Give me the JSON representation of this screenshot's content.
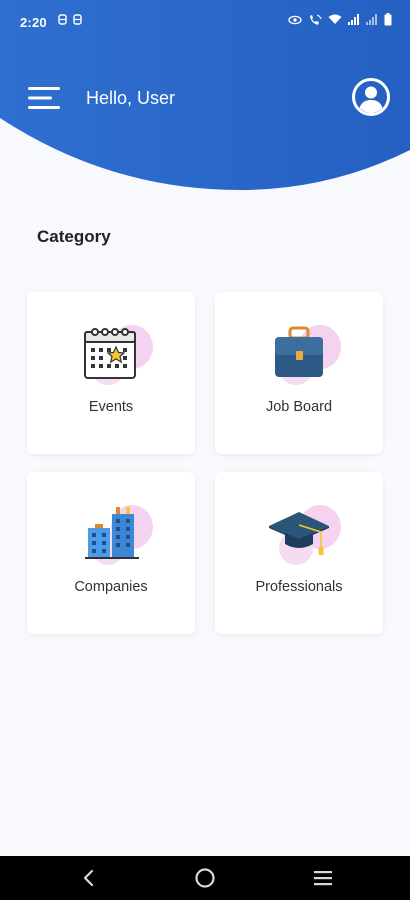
{
  "status_bar": {
    "time": "2:20"
  },
  "header": {
    "greeting": "Hello, User"
  },
  "section": {
    "title": "Category"
  },
  "categories": [
    {
      "label": "Events",
      "icon": "calendar-icon"
    },
    {
      "label": "Job Board",
      "icon": "briefcase-icon"
    },
    {
      "label": "Companies",
      "icon": "buildings-icon"
    },
    {
      "label": "Professionals",
      "icon": "graduation-cap-icon"
    }
  ],
  "colors": {
    "header_blue": "#2a67c9",
    "page_bg": "#f7f9fd",
    "blob": "#f3d3ef"
  }
}
